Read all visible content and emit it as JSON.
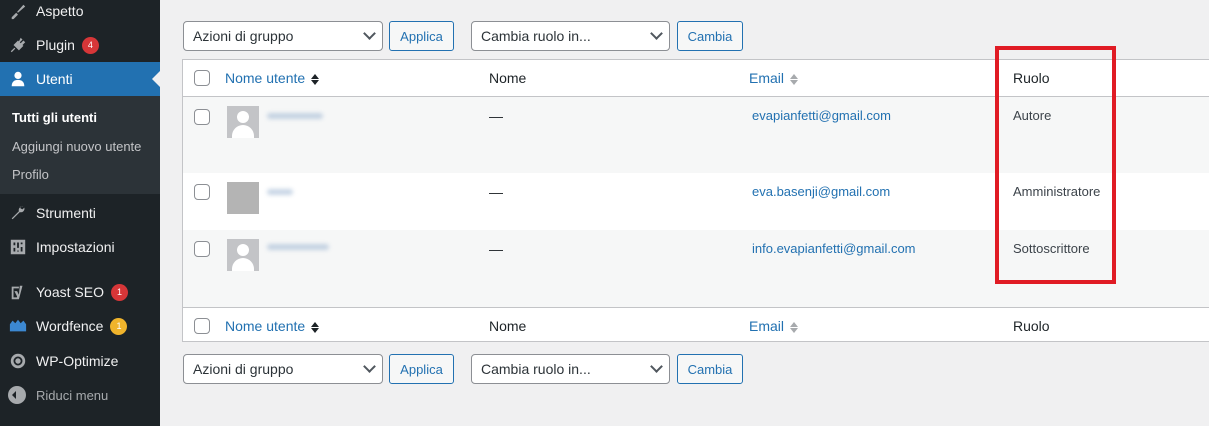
{
  "sidebar": {
    "items": [
      {
        "label": "Aspetto",
        "icon": "paintbrush-icon"
      },
      {
        "label": "Plugin",
        "icon": "plugin-icon",
        "badge": "4"
      },
      {
        "label": "Utenti",
        "icon": "user-icon"
      },
      {
        "label": "Strumenti",
        "icon": "wrench-icon"
      },
      {
        "label": "Impostazioni",
        "icon": "settings-sliders-icon"
      },
      {
        "label": "Yoast SEO",
        "icon": "yoast-icon",
        "badge": "1"
      },
      {
        "label": "Wordfence",
        "icon": "wordfence-icon",
        "badge": "1"
      },
      {
        "label": "WP-Optimize",
        "icon": "wp-optimize-icon"
      }
    ],
    "submenu": [
      "Tutti gli utenti",
      "Aggiungi nuovo utente",
      "Profilo"
    ],
    "collapse_label": "Riduci menu"
  },
  "bulk": {
    "actions_label": "Azioni di gruppo",
    "apply_label": "Applica",
    "role_label": "Cambia ruolo in...",
    "change_label": "Cambia"
  },
  "table": {
    "columns": {
      "username": "Nome utente",
      "name": "Nome",
      "email": "Email",
      "role": "Ruolo"
    },
    "rows": [
      {
        "name": "—",
        "email": "evapianfetti@gmail.com",
        "role": "Autore"
      },
      {
        "name": "—",
        "email": "eva.basenji@gmail.com",
        "role": "Amministratore"
      },
      {
        "name": "—",
        "email": "info.evapianfetti@gmail.com",
        "role": "Sottoscrittore"
      }
    ]
  },
  "colors": {
    "accent": "#2271b1",
    "sidebar": "#1d2327",
    "highlight": "#e01b24",
    "badge_red": "#d63638",
    "badge_orange": "#f0b42c"
  }
}
